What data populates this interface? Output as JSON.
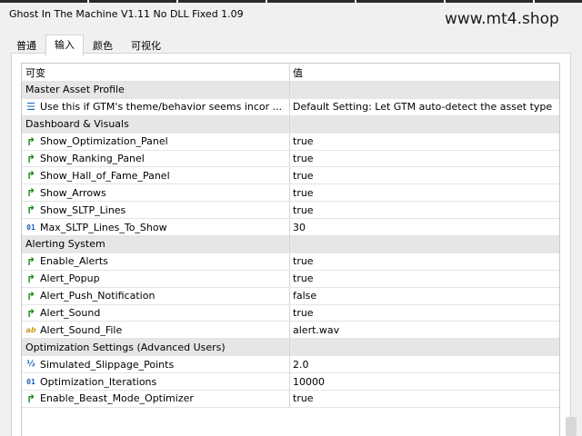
{
  "window": {
    "title": "Ghost In The Machine V1.11 No DLL Fixed 1.09",
    "watermark": "www.mt4.shop"
  },
  "tabs": [
    {
      "label": "普通",
      "active": false
    },
    {
      "label": "输入",
      "active": true
    },
    {
      "label": "颜色",
      "active": false
    },
    {
      "label": "可视化",
      "active": false
    }
  ],
  "table": {
    "headers": {
      "name": "可变",
      "value": "值"
    },
    "rows": [
      {
        "type": "group",
        "name": "Master Asset Profile",
        "value": ""
      },
      {
        "type": "param",
        "icon": "enum-icon",
        "name": "Use this if GTM's theme/behavior seems incorrect for your asset",
        "value": "Default Setting: Let GTM auto-detect the asset type"
      },
      {
        "type": "group",
        "name": "Dashboard & Visuals",
        "value": ""
      },
      {
        "type": "param",
        "icon": "bool-icon",
        "name": "Show_Optimization_Panel",
        "value": "true"
      },
      {
        "type": "param",
        "icon": "bool-icon",
        "name": "Show_Ranking_Panel",
        "value": "true"
      },
      {
        "type": "param",
        "icon": "bool-icon",
        "name": "Show_Hall_of_Fame_Panel",
        "value": "true"
      },
      {
        "type": "param",
        "icon": "bool-icon",
        "name": "Show_Arrows",
        "value": "true"
      },
      {
        "type": "param",
        "icon": "bool-icon",
        "name": "Show_SLTP_Lines",
        "value": "true"
      },
      {
        "type": "param",
        "icon": "int-icon",
        "name": "Max_SLTP_Lines_To_Show",
        "value": "30"
      },
      {
        "type": "group",
        "name": "Alerting System",
        "value": ""
      },
      {
        "type": "param",
        "icon": "bool-icon",
        "name": "Enable_Alerts",
        "value": "true"
      },
      {
        "type": "param",
        "icon": "bool-icon",
        "name": "Alert_Popup",
        "value": "true"
      },
      {
        "type": "param",
        "icon": "bool-icon",
        "name": "Alert_Push_Notification",
        "value": "false"
      },
      {
        "type": "param",
        "icon": "bool-icon",
        "name": "Alert_Sound",
        "value": "true"
      },
      {
        "type": "param",
        "icon": "string-icon",
        "name": "Alert_Sound_File",
        "value": "alert.wav"
      },
      {
        "type": "group",
        "name": "Optimization Settings (Advanced Users)",
        "value": ""
      },
      {
        "type": "param",
        "icon": "double-icon",
        "name": "Simulated_Slippage_Points",
        "value": "2.0"
      },
      {
        "type": "param",
        "icon": "int-icon",
        "name": "Optimization_Iterations",
        "value": "10000"
      },
      {
        "type": "param",
        "icon": "bool-icon",
        "name": "Enable_Beast_Mode_Optimizer",
        "value": "true"
      }
    ]
  }
}
